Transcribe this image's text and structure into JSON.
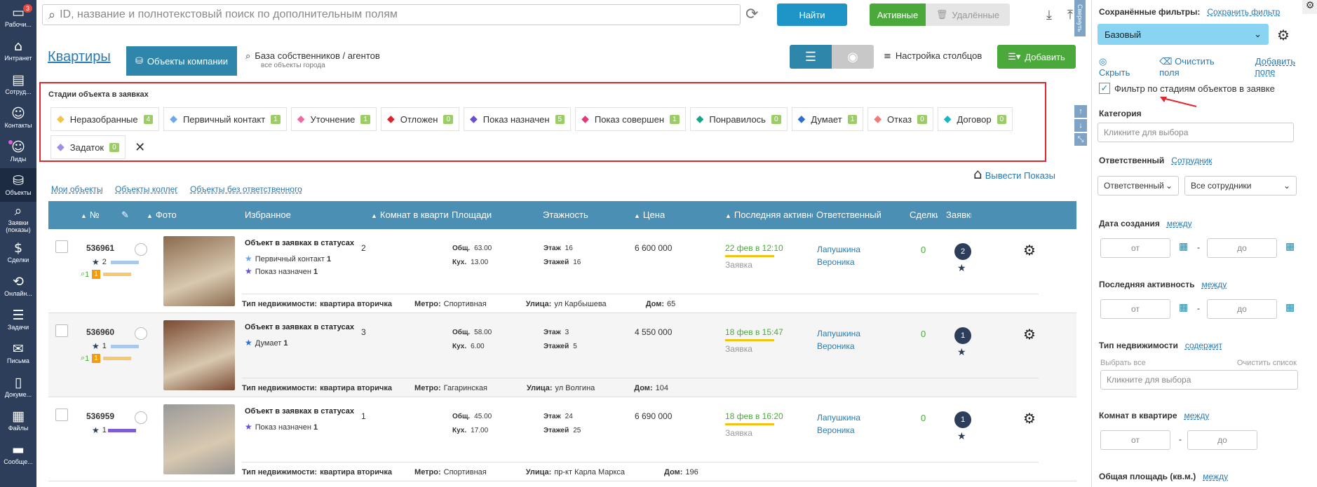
{
  "nav": [
    {
      "icon": "desktop-icon",
      "label": "Рабочи...",
      "badge": "3"
    },
    {
      "icon": "home-icon",
      "label": "Интранет"
    },
    {
      "icon": "id-card-icon",
      "label": "Сотруд..."
    },
    {
      "icon": "user-icon",
      "label": "Контакты"
    },
    {
      "icon": "user-plus-icon",
      "label": "Лиды"
    },
    {
      "icon": "database-icon",
      "label": "Объекты",
      "active": true
    },
    {
      "icon": "search-icon",
      "label": "Заявки (показы)"
    },
    {
      "icon": "dollar-icon",
      "label": "Сделки"
    },
    {
      "icon": "online-icon",
      "label": "Онлайн..."
    },
    {
      "icon": "tasks-icon",
      "label": "Задачи"
    },
    {
      "icon": "mail-icon",
      "label": "Письма"
    },
    {
      "icon": "document-icon",
      "label": "Докуме..."
    },
    {
      "icon": "files-icon",
      "label": "Файлы"
    },
    {
      "icon": "message-icon",
      "label": "Сообще..."
    }
  ],
  "top": {
    "search_placeholder": "ID, название и полнотекстовый поиск по дополнительным полям",
    "find": "Найти",
    "active": "Активные",
    "deleted": "Удалённые",
    "collapse": "Свернуть"
  },
  "header": {
    "title": "Квартиры",
    "tab_company": "Объекты компании",
    "tab_base": "База собственников / агентов",
    "tab_base_sub": "все объекты города",
    "columns": "Настройка столбцов",
    "add": "Добавить"
  },
  "stages": {
    "title": "Стадии объекта в заявках",
    "items": [
      {
        "label": "Неразобранные",
        "count": "4",
        "color": "#f5c343"
      },
      {
        "label": "Первичный контакт",
        "count": "1",
        "color": "#6fa8e8"
      },
      {
        "label": "Уточнение",
        "count": "1",
        "color": "#f06ba6"
      },
      {
        "label": "Отложен",
        "count": "0",
        "color": "#d9262e"
      },
      {
        "label": "Показ назначен",
        "count": "5",
        "color": "#6a4fd0"
      },
      {
        "label": "Показ совершен",
        "count": "1",
        "color": "#e8387a"
      },
      {
        "label": "Понравилось",
        "count": "0",
        "color": "#17a589"
      },
      {
        "label": "Думает",
        "count": "1",
        "color": "#2e6fd1"
      },
      {
        "label": "Отказ",
        "count": "0",
        "color": "#f07a7a"
      },
      {
        "label": "Договор",
        "count": "0",
        "color": "#1bb6c4"
      },
      {
        "label": "Задаток",
        "count": "0",
        "color": "#9c8ee8"
      }
    ]
  },
  "shows": "Вывести Показы",
  "links": [
    "Мои объекты",
    "Объекты коллег",
    "Объекты без ответственного"
  ],
  "table": {
    "headers": [
      "№",
      "",
      "Фото",
      "Избранное",
      "Комнат в квартире",
      "Площади",
      "Этажность",
      "Цена",
      "Последняя активность",
      "Ответственный",
      "Сделки",
      "Заявки"
    ],
    "rows": [
      {
        "id": "536961",
        "stars": "2",
        "views": "1",
        "views_o": "1",
        "fav_title": "Объект в заявках в статусах",
        "fav": [
          {
            "label": "Первичный контакт",
            "n": "1",
            "color": "#6fa8e8"
          },
          {
            "label": "Показ назначен",
            "n": "1",
            "color": "#6a4fd0"
          }
        ],
        "rooms": "2",
        "area_total": "63.00",
        "area_kitchen": "13.00",
        "floor": "16",
        "floors": "16",
        "price": "6 600 000",
        "activity": "22 фев в 12:10",
        "activity_sub": "Заявка",
        "resp1": "Лапушкина",
        "resp2": "Вероника",
        "deals": "0",
        "req": "2",
        "type": "квартира вторичка",
        "metro": "Спортивная",
        "street": "ул Карбышева",
        "house": "65",
        "photo": "#8a6b4e"
      },
      {
        "id": "536960",
        "stars": "1",
        "views": "1",
        "views_o": "1",
        "fav_title": "Объект в заявках в статусах",
        "fav": [
          {
            "label": "Думает",
            "n": "1",
            "color": "#2e6fd1"
          }
        ],
        "rooms": "3",
        "area_total": "58.00",
        "area_kitchen": "6.00",
        "floor": "3",
        "floors": "5",
        "price": "4 550 000",
        "activity": "18 фев в 15:47",
        "activity_sub": "Заявка",
        "resp1": "Лапушкина",
        "resp2": "Вероника",
        "deals": "0",
        "req": "1",
        "type": "квартира вторичка",
        "metro": "Гагаринская",
        "street": "ул Волгина",
        "house": "104",
        "photo": "#7a4a32"
      },
      {
        "id": "536959",
        "stars": "1",
        "views": "",
        "views_o": "",
        "fav_title": "Объект в заявках в статусах",
        "fav": [
          {
            "label": "Показ назначен",
            "n": "1",
            "color": "#6a4fd0"
          }
        ],
        "rooms": "1",
        "area_total": "45.00",
        "area_kitchen": "17.00",
        "floor": "24",
        "floors": "25",
        "price": "6 690 000",
        "activity": "18 фев в 16:20",
        "activity_sub": "Заявка",
        "resp1": "Лапушкина",
        "resp2": "Вероника",
        "deals": "0",
        "req": "1",
        "type": "квартира вторичка",
        "metro": "Спортивная",
        "street": "пр-кт Карла Маркса",
        "house": "196",
        "photo": "#9a9a9a"
      }
    ],
    "labels": {
      "area_total": "Общ.",
      "area_kitchen": "Кух.",
      "floor": "Этаж",
      "floors": "Этажей",
      "type": "Тип недвижимости:",
      "metro": "Метро:",
      "street": "Улица:",
      "house": "Дом:"
    }
  },
  "panel": {
    "saved_filters": "Сохранённые фильтры:",
    "save_filter": "Сохранить фильтр",
    "base": "Базовый",
    "hide": "Скрыть",
    "clear": "Очистить поля",
    "add_field": "Добавить поле",
    "stage_filter": "Фильтр по стадиям объектов в заявке",
    "category": "Категория",
    "click_choose": "Кликните для выбора",
    "responsible": "Ответственный",
    "employee": "Сотрудник",
    "resp_sel": "Ответственный",
    "all_emp": "Все сотрудники",
    "created": "Дата создания",
    "between": "между",
    "from": "от",
    "to": "до",
    "last_act": "Последняя активность",
    "prop_type": "Тип недвижимости",
    "contains": "содержит",
    "select_all": "Выбрать все",
    "clear_list": "Очистить список",
    "rooms": "Комнат в квартире",
    "total_area": "Общая площадь (кв.м.)"
  }
}
